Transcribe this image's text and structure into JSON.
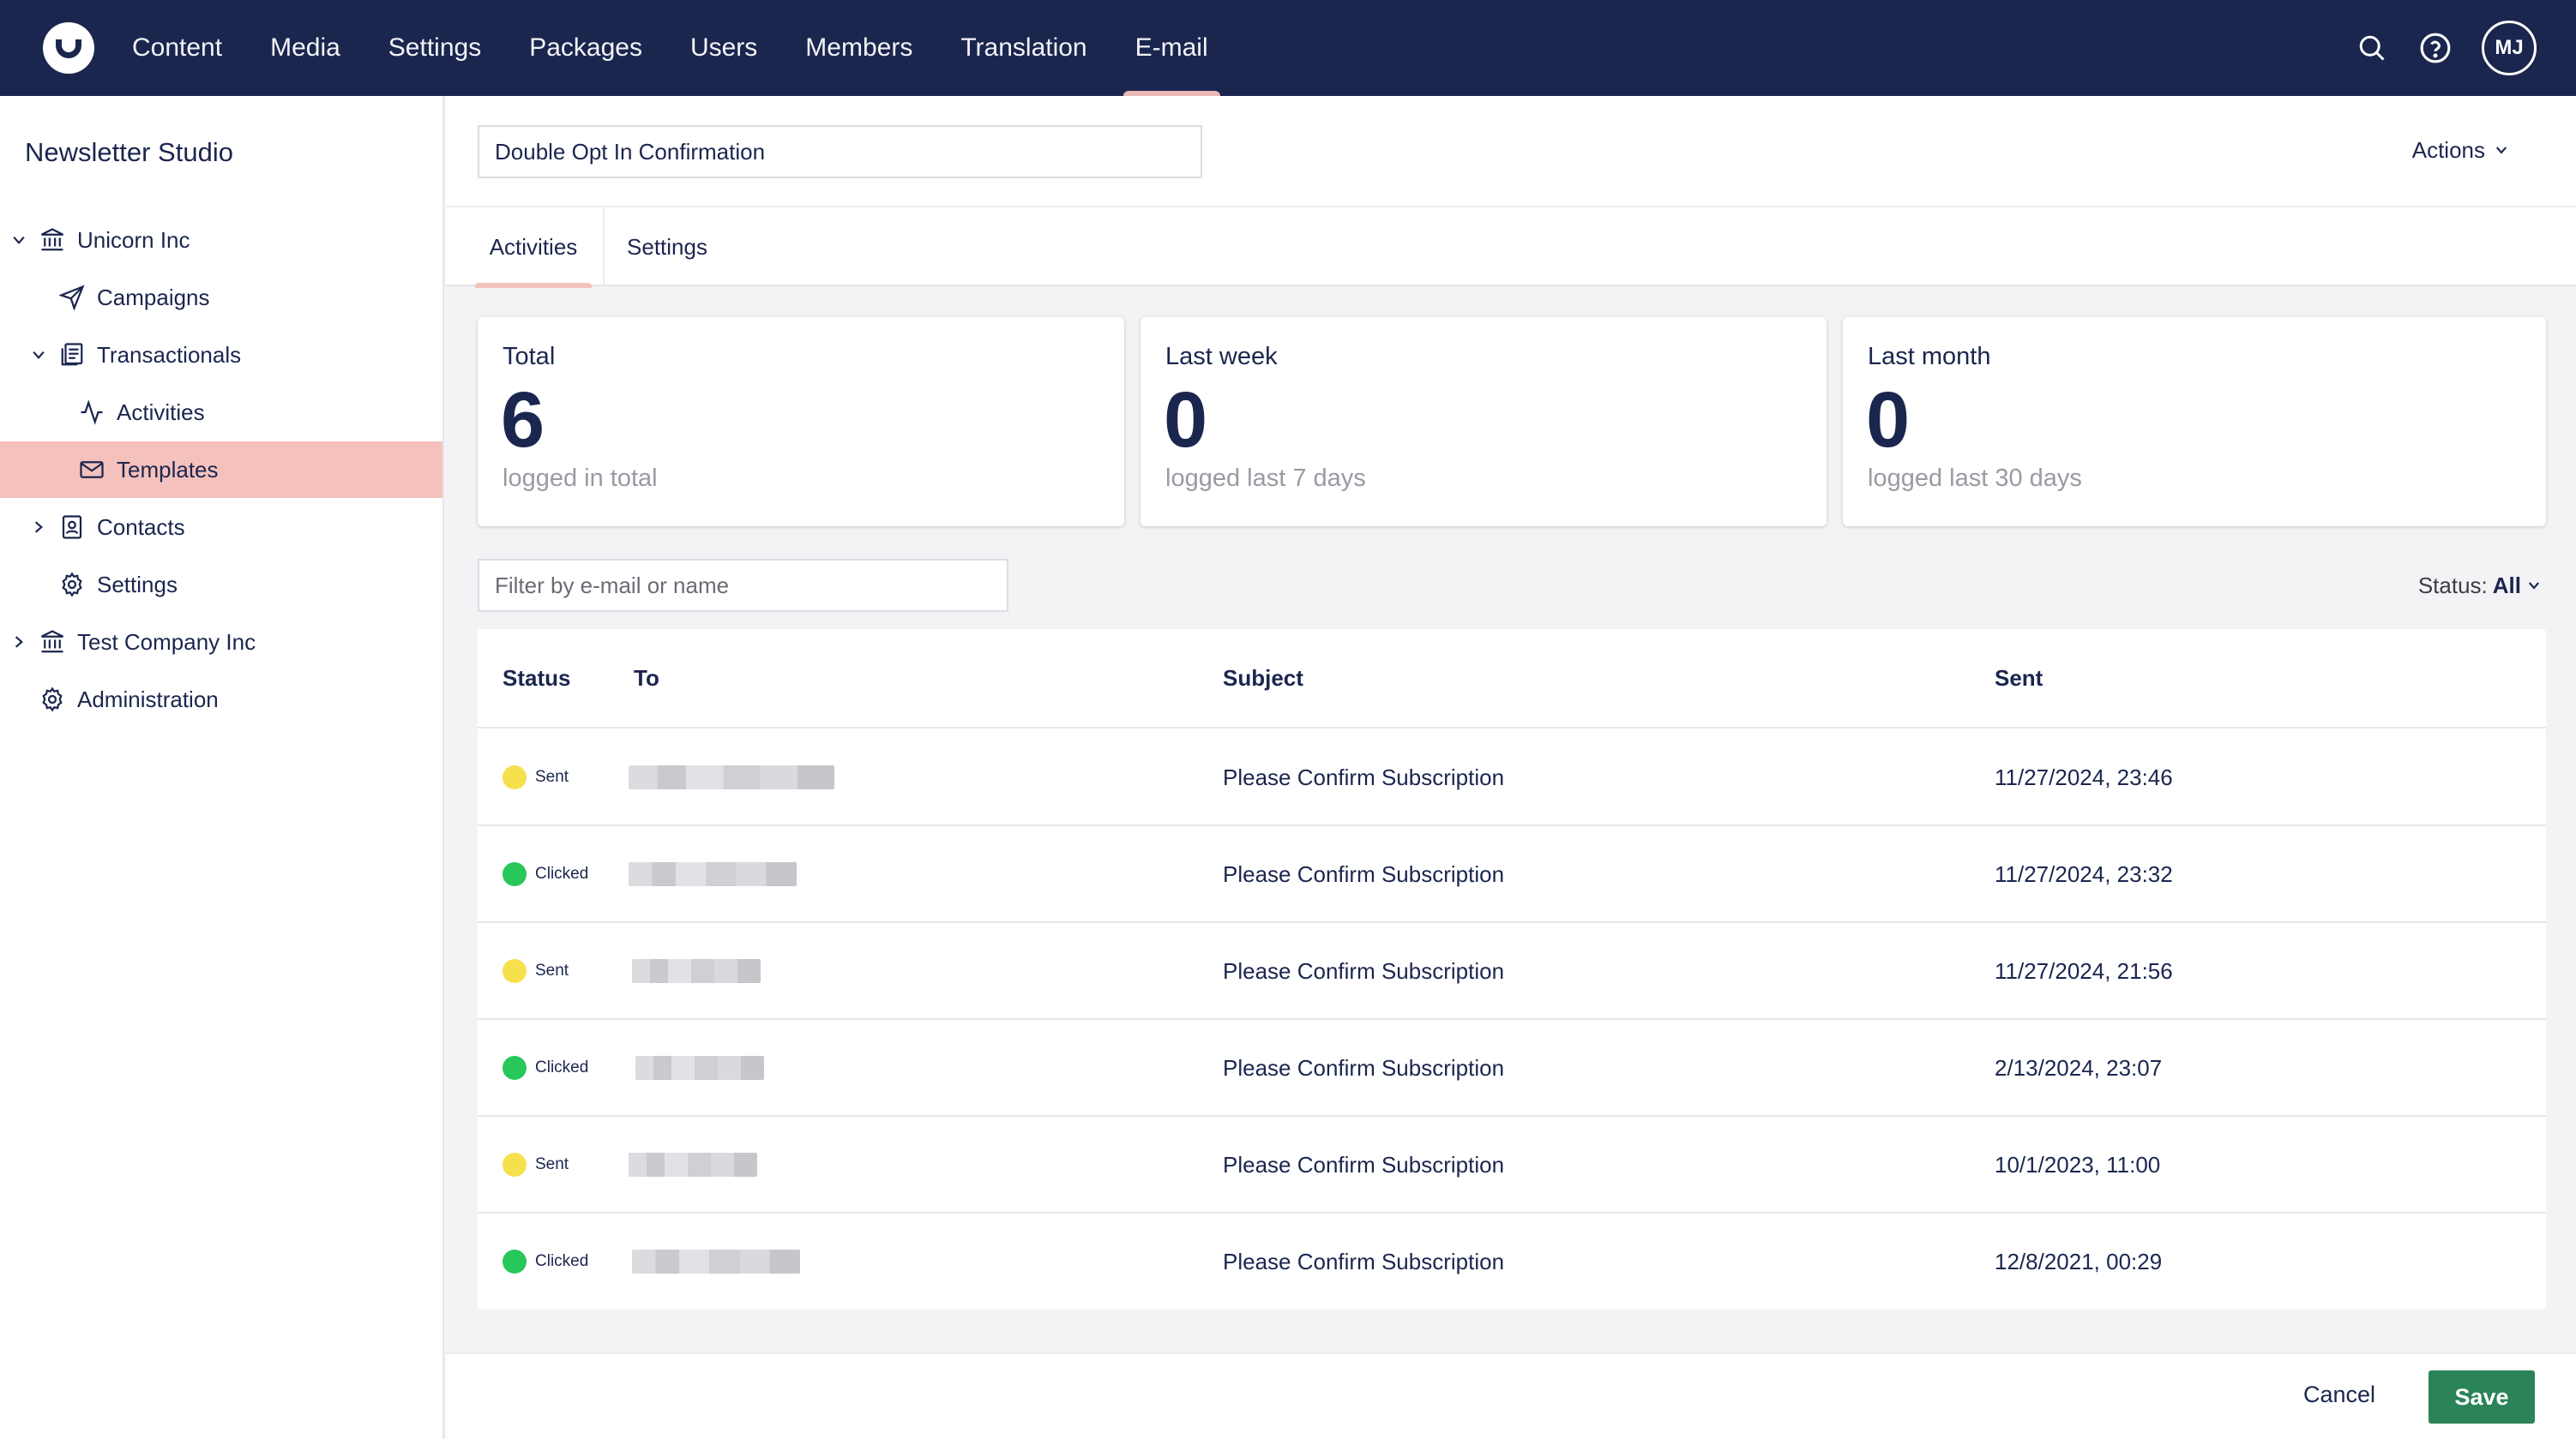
{
  "nav": {
    "items": [
      "Content",
      "Media",
      "Settings",
      "Packages",
      "Users",
      "Members",
      "Translation",
      "E-mail"
    ],
    "active": "E-mail",
    "avatar_initials": "MJ",
    "icons": [
      "search-icon",
      "help-icon"
    ]
  },
  "sidebar": {
    "title": "Newsletter Studio",
    "items": [
      {
        "label": "Unicorn Inc",
        "icon": "building-icon",
        "caret": "expanded"
      },
      {
        "label": "Campaigns",
        "icon": "send-icon"
      },
      {
        "label": "Transactionals",
        "icon": "document-stack-icon",
        "caret": "expanded"
      },
      {
        "label": "Activities",
        "icon": "activity-icon"
      },
      {
        "label": "Templates",
        "icon": "envelope-icon",
        "selected": true
      },
      {
        "label": "Contacts",
        "icon": "contact-book-icon",
        "caret": "collapsed"
      },
      {
        "label": "Settings",
        "icon": "gear-icon"
      },
      {
        "label": "Test Company Inc",
        "icon": "building-icon",
        "caret": "collapsed"
      },
      {
        "label": "Administration",
        "icon": "gear-icon"
      }
    ]
  },
  "header": {
    "name_value": "Double Opt In Confirmation",
    "actions_label": "Actions"
  },
  "tabs": [
    {
      "label": "Activities",
      "active": true
    },
    {
      "label": "Settings",
      "active": false
    }
  ],
  "stats": [
    {
      "title": "Total",
      "value": "6",
      "desc": "logged in total"
    },
    {
      "title": "Last week",
      "value": "0",
      "desc": "logged last 7 days"
    },
    {
      "title": "Last month",
      "value": "0",
      "desc": "logged last 30 days"
    }
  ],
  "filter": {
    "placeholder": "Filter by e-mail or name",
    "status_label": "Status:",
    "status_value": "All"
  },
  "table": {
    "headers": [
      "Status",
      "To",
      "Subject",
      "Sent"
    ],
    "rows": [
      {
        "status": "Sent",
        "subject": "Please Confirm Subscription",
        "sent": "11/27/2024, 23:46"
      },
      {
        "status": "Clicked",
        "subject": "Please Confirm Subscription",
        "sent": "11/27/2024, 23:32"
      },
      {
        "status": "Sent",
        "subject": "Please Confirm Subscription",
        "sent": "11/27/2024, 21:56"
      },
      {
        "status": "Clicked",
        "subject": "Please Confirm Subscription",
        "sent": "2/13/2024, 23:07"
      },
      {
        "status": "Sent",
        "subject": "Please Confirm Subscription",
        "sent": "10/1/2023, 11:00"
      },
      {
        "status": "Clicked",
        "subject": "Please Confirm Subscription",
        "sent": "12/8/2021, 00:29"
      }
    ]
  },
  "footer": {
    "cancel_label": "Cancel",
    "save_label": "Save"
  },
  "colors": {
    "topbar": "#1b264f",
    "accent_pink": "#f5c1bc",
    "save_green": "#2b8358",
    "status_sent": "#f6e04b",
    "status_clicked": "#27c75a"
  }
}
